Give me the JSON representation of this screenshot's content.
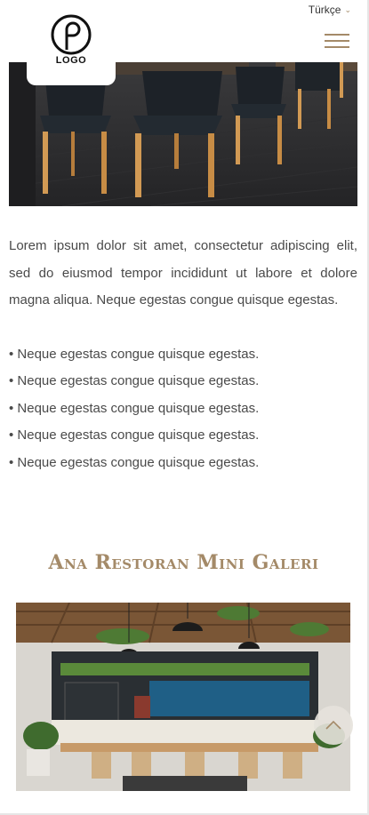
{
  "header": {
    "language": "Türkçe",
    "logo_text": "LOGO",
    "language_chevron_icon": "chevron-down-icon",
    "menu_icon": "hamburger-menu-icon"
  },
  "content": {
    "paragraph": "Lorem ipsum dolor sit amet, consectetur adipiscing elit, sed do eiusmod tempor incididunt ut labore et dolore magna aliqua. Neque egestas congue quisque egestas.",
    "bullets": [
      "• Neque egestas congue quisque egestas.",
      "• Neque egestas congue quisque egestas.",
      "• Neque egestas congue quisque egestas.",
      "• Neque egestas congue quisque egestas.",
      "• Neque egestas congue quisque egestas."
    ]
  },
  "gallery": {
    "title": "Ana Restoran Mini Galeri"
  },
  "scroll_top": {
    "icon": "chevron-up-icon"
  },
  "colors": {
    "accent": "#a48a68",
    "text": "#4a4a4a"
  }
}
